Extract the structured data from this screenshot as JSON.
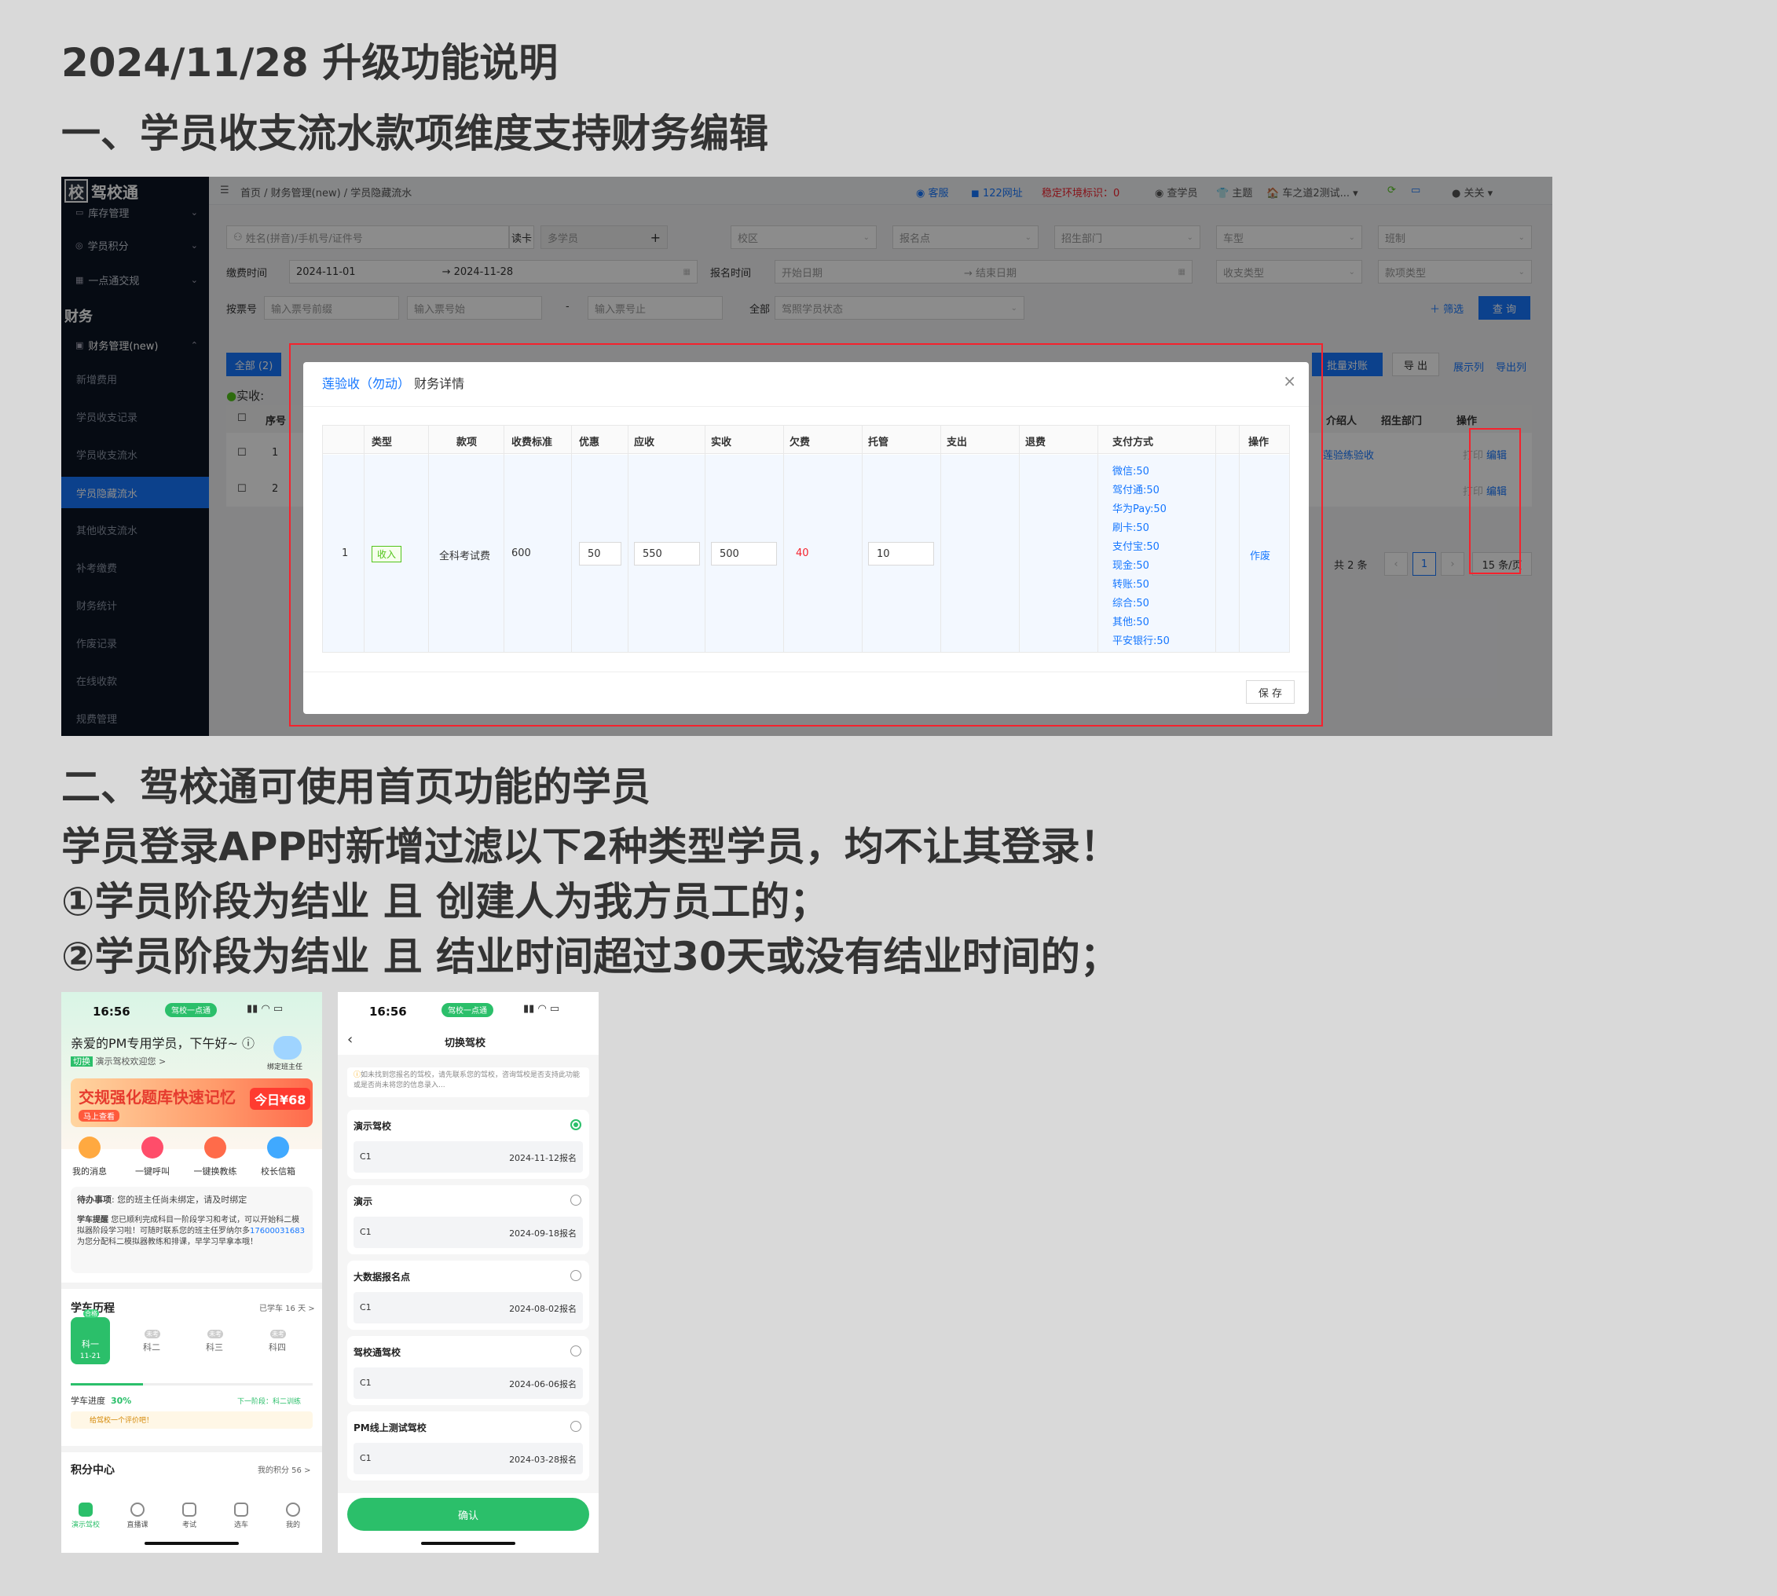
{
  "doc": {
    "title": "2024/11/28  升级功能说明",
    "section1": "一、学员收支流水款项维度支持财务编辑",
    "section2": "二、驾校通可使用首页功能的学员",
    "desc": "学员登录APP时新增过滤以下2种类型学员，均不让其登录！",
    "rule1": "①学员阶段为结业 且 创建人为我方员工的；",
    "rule2": "②学员阶段为结业 且 结业时间超过30天或没有结业时间的；"
  },
  "shot1": {
    "brand": "驾校通",
    "brand_badge": "校",
    "side_items": [
      {
        "label": "库存管理"
      },
      {
        "label": "学员积分"
      },
      {
        "label": "一点通交规"
      }
    ],
    "side_section": "财务",
    "side_group": "财务管理(new)",
    "side_subs": [
      {
        "label": "新增费用"
      },
      {
        "label": "学员收支记录"
      },
      {
        "label": "学员收支流水"
      },
      {
        "label": "学员隐藏流水"
      },
      {
        "label": "其他收支流水"
      },
      {
        "label": "补考缴费"
      },
      {
        "label": "财务统计"
      },
      {
        "label": "作废记录"
      },
      {
        "label": "在线收款"
      },
      {
        "label": "规费管理"
      }
    ],
    "breadcrumb": "首页 / 财务管理(new) / 学员隐藏流水",
    "top": {
      "kefu": "客服",
      "site": "122网址",
      "env": "稳定环境标识：",
      "env_val": "0",
      "check": "查学员",
      "theme": "主题",
      "school": "车之道2测试...",
      "user": "关关"
    },
    "filters": {
      "name_ph": "姓名(拼音)/手机号/证件号",
      "read_card": "读卡",
      "multi": "多学员",
      "campus": "校区",
      "signup": "报名点",
      "dept": "招生部门",
      "car": "车型",
      "class": "班制",
      "pay_time": "缴费时间",
      "date_from": "2024-11-01",
      "date_to": "2024-11-28",
      "reg_time": "报名时间",
      "start_ph": "开始日期",
      "end_ph": "结束日期",
      "io_type": "收支类型",
      "item_type": "款项类型",
      "ticket": "按票号",
      "ticket_pre": "输入票号前缀",
      "ticket_start": "输入票号始",
      "ticket_end": "输入票号止",
      "all": "全部",
      "status": "驾照学员状态",
      "filter_btn": "筛选",
      "search_btn": "查 询",
      "tab_all": "全部 (2)",
      "actual": "实收:",
      "batch": "批量对账",
      "export": "导 出",
      "show_cols": "展示列",
      "export_cols": "导出列",
      "col_no": "序号",
      "col_ref": "介绍人",
      "col_dept": "招生部门",
      "col_op": "操作",
      "row_ref": "莲验练验收",
      "print": "打印",
      "edit": "编辑",
      "row1": "1",
      "row2": "2",
      "total": "共 2 条",
      "page": "1",
      "per_page": "15 条/页"
    },
    "modal": {
      "title_link": "莲验收（勿动）",
      "title": "财务详情",
      "close": "×",
      "headers": [
        "类型",
        "款项",
        "收费标准",
        "优惠",
        "应收",
        "实收",
        "欠费",
        "托管",
        "支出",
        "退费",
        "支付方式",
        "操作"
      ],
      "row": {
        "no": "1",
        "type": "收入",
        "item": "全科考试费",
        "standard": "600",
        "discount": "50",
        "receivable": "550",
        "received": "500",
        "owed": "40",
        "escrow": "10",
        "action": "作废"
      },
      "payments": [
        "微信:50",
        "驾付通:50",
        "华为Pay:50",
        "刷卡:50",
        "支付宝:50",
        "现金:50",
        "转账:50",
        "综合:50",
        "其他:50",
        "平安银行:50"
      ],
      "save": "保 存"
    }
  },
  "phone1": {
    "time": "16:56",
    "pill": "驾校一点通",
    "greet": "亲爱的PM专用学员，下午好~ ⓘ",
    "switch": "切换",
    "welcome": "演示驾校欢迎您 >",
    "head_teacher": "绑定班主任",
    "banner": "交规强化题库快速记忆",
    "banner_sub": "马上查看",
    "banner_price": "今日¥68",
    "quick": [
      {
        "label": "我的消息"
      },
      {
        "label": "一键呼叫"
      },
      {
        "label": "一键换教练"
      },
      {
        "label": "校长信箱"
      }
    ],
    "todo_title": "待办事项",
    "todo1": "您的班主任尚未绑定，请及时绑定",
    "todo2_title": "学车提醒",
    "todo2": "您已顺利完成科目一阶段学习和考试，可以开始科二模拟器阶段学习啦！可随时联系您的班主任罗纳尔多",
    "phone_num": "17600031683",
    "todo2_end": "为您分配科二模拟器教练和排课，早学习早拿本哦！",
    "history": "学车历程",
    "days": "已学车 16 天 >",
    "stages": [
      {
        "label": "科一",
        "badge": "合格",
        "date": "11-21"
      },
      {
        "label": "科二",
        "badge": "未考"
      },
      {
        "label": "科三",
        "badge": "未考"
      },
      {
        "label": "科四",
        "badge": "未考"
      }
    ],
    "progress_label": "学车进度",
    "progress": "30%",
    "progress_frac": 0.3,
    "next": "下一阶段：科二训练",
    "rate": "给驾校一个评价吧！",
    "points": "积分中心",
    "my_points": "我的积分 56 >",
    "tabs": [
      {
        "label": "演示驾校"
      },
      {
        "label": "直播课"
      },
      {
        "label": "考试"
      },
      {
        "label": "选车"
      },
      {
        "label": "我的"
      }
    ]
  },
  "phone2": {
    "time": "16:56",
    "pill": "驾校一点通",
    "title": "切换驾校",
    "tip": "如未找到您报名的驾校，请先联系您的驾校，咨询驾校是否支持此功能或是否尚未将您的信息录入...",
    "schools": [
      {
        "name": "演示驾校",
        "car": "C1",
        "date": "2024-11-12报名",
        "selected": true
      },
      {
        "name": "演示",
        "car": "C1",
        "date": "2024-09-18报名",
        "selected": false
      },
      {
        "name": "大数据报名点",
        "car": "C1",
        "date": "2024-08-02报名",
        "selected": false
      },
      {
        "name": "驾校通驾校",
        "car": "C1",
        "date": "2024-06-06报名",
        "selected": false
      },
      {
        "name": "PM线上测试驾校",
        "car": "C1",
        "date": "2024-03-28报名",
        "selected": false
      }
    ],
    "confirm": "确认"
  }
}
